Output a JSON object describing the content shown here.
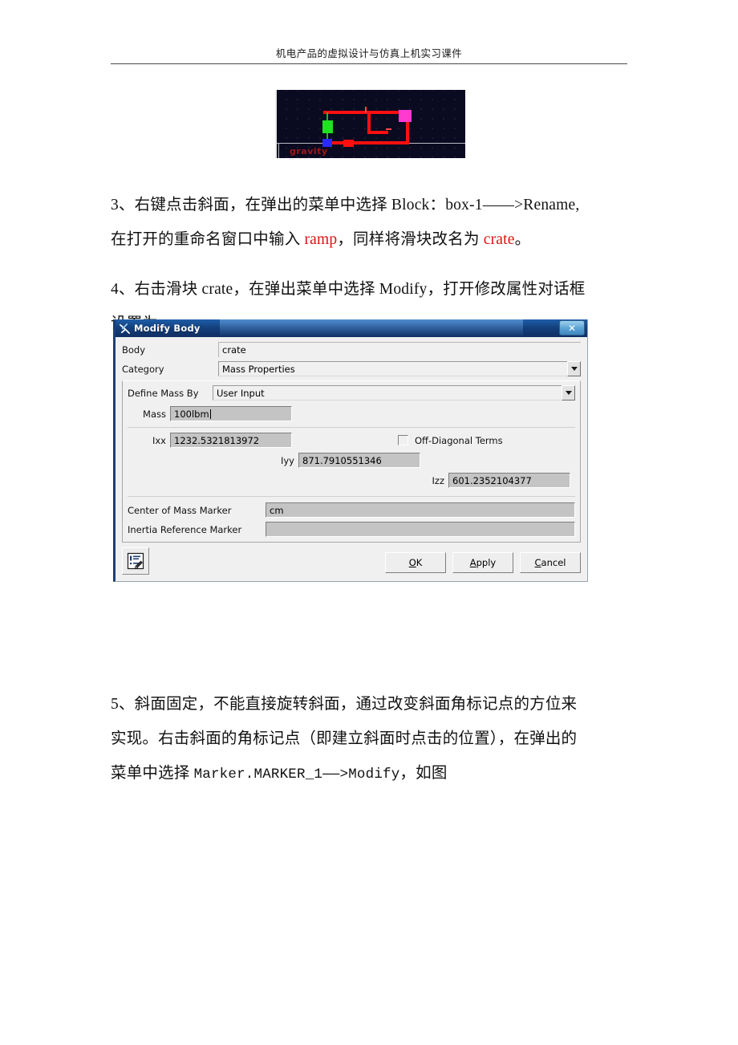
{
  "page": {
    "header_text": "机电产品的虚拟设计与仿真上机实习课件"
  },
  "figure": {
    "name": "adams-model-viewport",
    "gravity_label": "gravity"
  },
  "steps": {
    "step3": {
      "part1": "3、右键点击斜面，在弹出的菜单中选择 Block：box-1——>Rename,",
      "part2_a": "在打开的重命名窗口中输入 ",
      "part2_red1": "ramp",
      "part2_b": "，同样将滑块改名为 ",
      "part2_red2": "crate",
      "part2_c": "。"
    },
    "step4": {
      "line1": "4、右击滑块 crate，在弹出菜单中选择 Modify，打开修改属性对话框",
      "line2": "设置为"
    },
    "step5": {
      "line1": "5、斜面固定，不能直接旋转斜面，通过改变斜面角标记点的方位来",
      "line2": "实现。右击斜面的角标记点（即建立斜面时点击的位置），在弹出的",
      "line3_a": "菜单中选择 ",
      "line3_mono": "Marker.MARKER_1——>Modify",
      "line3_b": "，如图"
    }
  },
  "dialog": {
    "title": "Modify Body",
    "close_label": "✕",
    "fields": {
      "body_label": "Body",
      "body_value": "crate",
      "category_label": "Category",
      "category_value": "Mass Properties",
      "define_mass_by_label": "Define Mass By",
      "define_mass_by_value": "User Input",
      "mass_label": "Mass",
      "mass_value": "100lbm",
      "ixx_label": "Ixx",
      "ixx_value": "1232.5321813972",
      "iyy_label": "Iyy",
      "iyy_value": "871.7910551346",
      "izz_label": "Izz",
      "izz_value": "601.2352104377",
      "off_diagonal_label": "Off-Diagonal Terms",
      "off_diagonal_checked": false,
      "cm_marker_label": "Center of Mass Marker",
      "cm_marker_value": "cm",
      "inertia_marker_label": "Inertia Reference Marker",
      "inertia_marker_value": ""
    },
    "buttons": {
      "ok": "OK",
      "apply": "Apply",
      "cancel": "Cancel"
    }
  },
  "colors": {
    "titlebar_blue": "#14407e",
    "accent_red": "#e01010",
    "field_gray": "#c4c4c4",
    "dialog_bg": "#f0f0f0"
  }
}
